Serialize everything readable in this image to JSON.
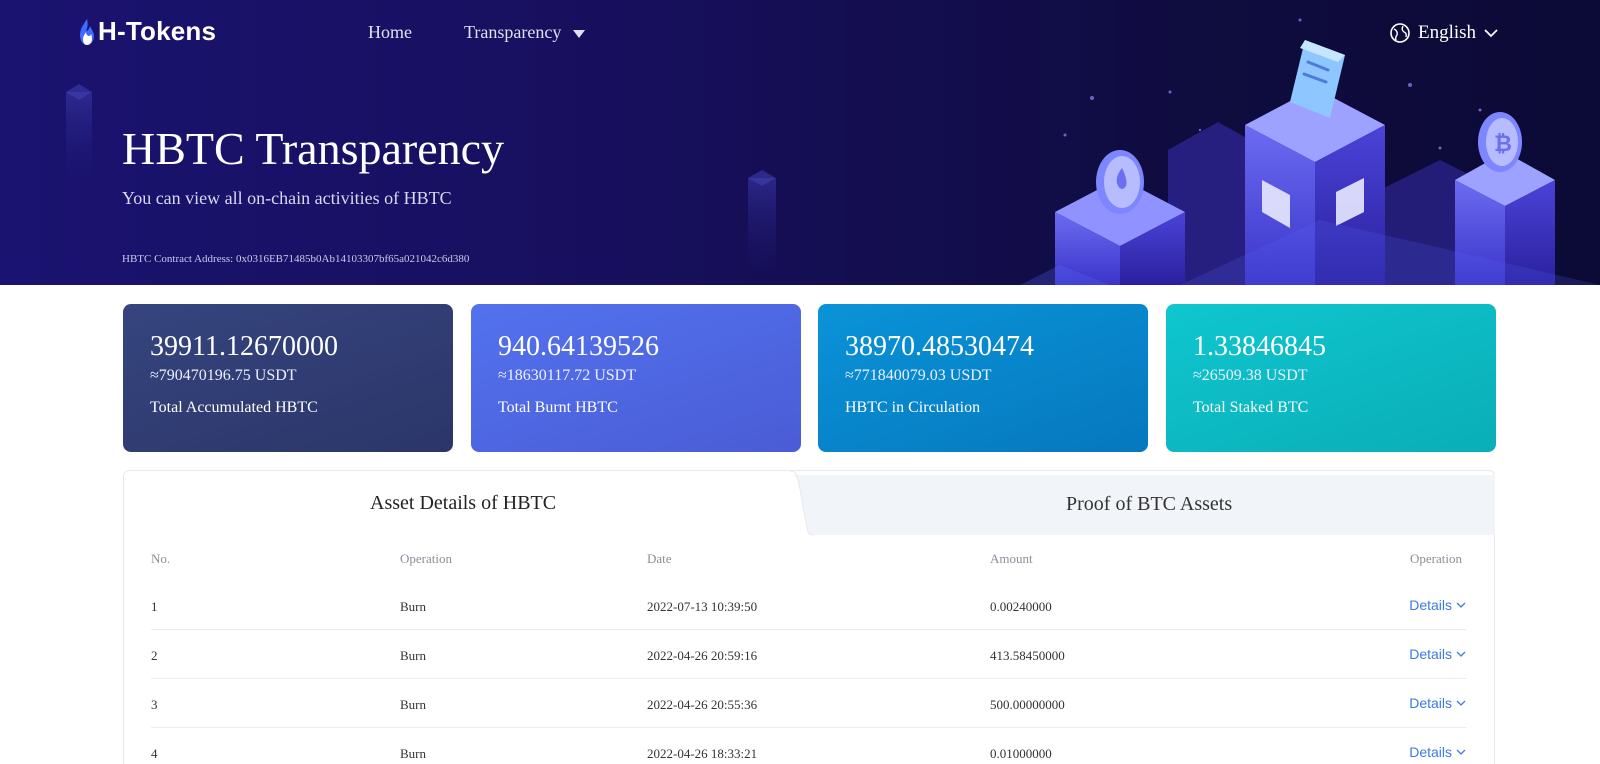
{
  "nav": {
    "logo_text": "H-Tokens",
    "home": "Home",
    "transparency": "Transparency",
    "language": "English"
  },
  "hero": {
    "title": "HBTC Transparency",
    "subtitle": "You can view all on-chain activities of HBTC",
    "contract_address": "HBTC Contract Address: 0x0316EB71485b0Ab14103307bf65a021042c6d380"
  },
  "cards": [
    {
      "value": "39911.12670000",
      "usdt": "≈790470196.75 USDT",
      "label": "Total Accumulated HBTC"
    },
    {
      "value": "940.64139526",
      "usdt": "≈18630117.72 USDT",
      "label": "Total Burnt HBTC"
    },
    {
      "value": "38970.48530474",
      "usdt": "≈771840079.03 USDT",
      "label": "HBTC in Circulation"
    },
    {
      "value": "1.33846845",
      "usdt": "≈26509.38 USDT",
      "label": "Total Staked BTC"
    }
  ],
  "tabs": {
    "active": "Asset Details of HBTC",
    "inactive": "Proof of BTC Assets"
  },
  "table": {
    "headers": [
      "No.",
      "Operation",
      "Date",
      "Amount",
      "Operation"
    ],
    "details_label": "Details",
    "rows": [
      {
        "no": "1",
        "operation": "Burn",
        "date": "2022-07-13 10:39:50",
        "amount": "0.00240000"
      },
      {
        "no": "2",
        "operation": "Burn",
        "date": "2022-04-26 20:59:16",
        "amount": "413.58450000"
      },
      {
        "no": "3",
        "operation": "Burn",
        "date": "2022-04-26 20:55:36",
        "amount": "500.00000000"
      },
      {
        "no": "4",
        "operation": "Burn",
        "date": "2022-04-26 18:33:21",
        "amount": "0.01000000"
      }
    ]
  },
  "colors": {
    "hero_bg": "#170f5c",
    "card1": "#2f3b72",
    "card2": "#4f68e3",
    "card3": "#0886cb",
    "card4": "#0cbac3",
    "link": "#3b7be0"
  }
}
